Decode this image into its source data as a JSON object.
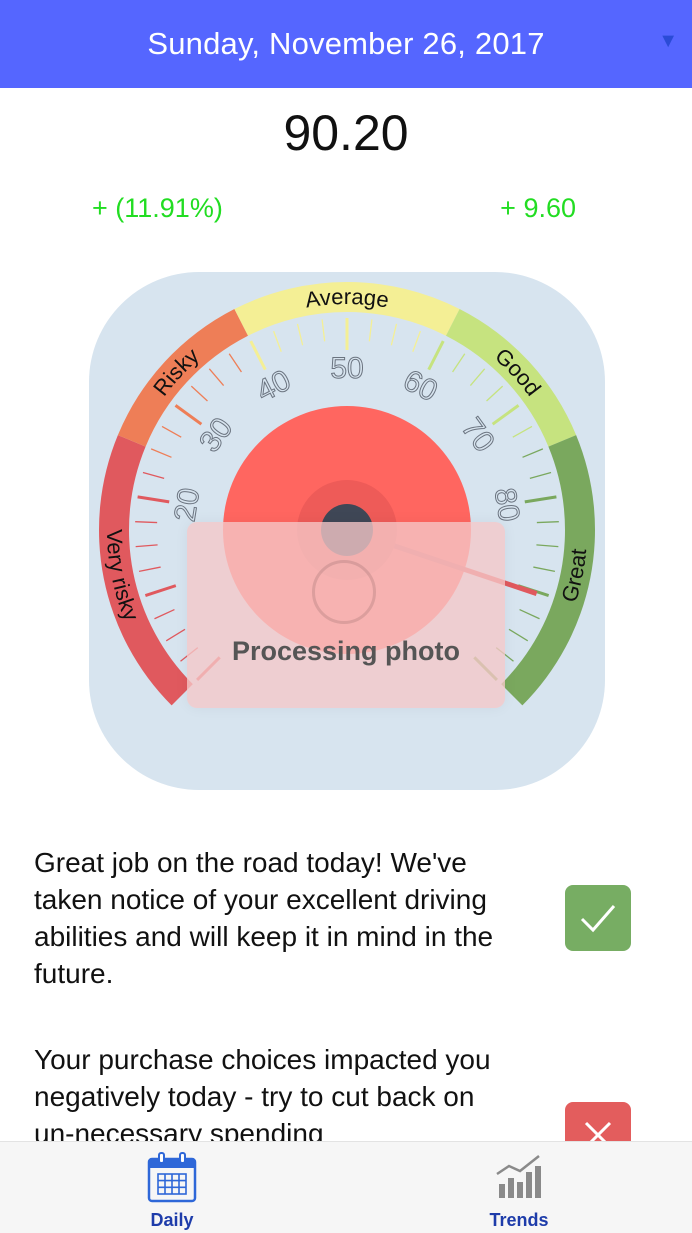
{
  "header": {
    "date": "Sunday, November 26, 2017",
    "menu_icon": "caret-down-icon"
  },
  "score": {
    "value": "90.20",
    "percent_change": "+ (11.91%)",
    "delta": "+ 9.60"
  },
  "gauge": {
    "needle_value": 90.2,
    "zones": [
      "Very risky",
      "Risky",
      "Average",
      "Good",
      "Great"
    ],
    "ticks": [
      "20",
      "30",
      "40",
      "50",
      "60",
      "70",
      "80"
    ],
    "colors": {
      "very_risky": "#e0595e",
      "risky": "#ee7e57",
      "average": "#f4ef95",
      "good": "#c6e37f",
      "great": "#7aa85e",
      "center": "#ff6660",
      "background": "#d7e4ef"
    }
  },
  "overlay": {
    "label": "Processing photo"
  },
  "messages": [
    {
      "text": "Great job on the road today! We've taken notice of your excellent driving abilities and will keep it in mind in the future.",
      "status": "positive",
      "icon": "checkmark-icon"
    },
    {
      "text": "Your purchase choices impacted you negatively today - try to cut back on un-necessary spending",
      "status": "negative",
      "icon": "close-icon"
    }
  ],
  "tabs": [
    {
      "label": "Daily",
      "icon": "calendar-icon",
      "selected": true
    },
    {
      "label": "Trends",
      "icon": "bar-chart-icon",
      "selected": false
    }
  ]
}
